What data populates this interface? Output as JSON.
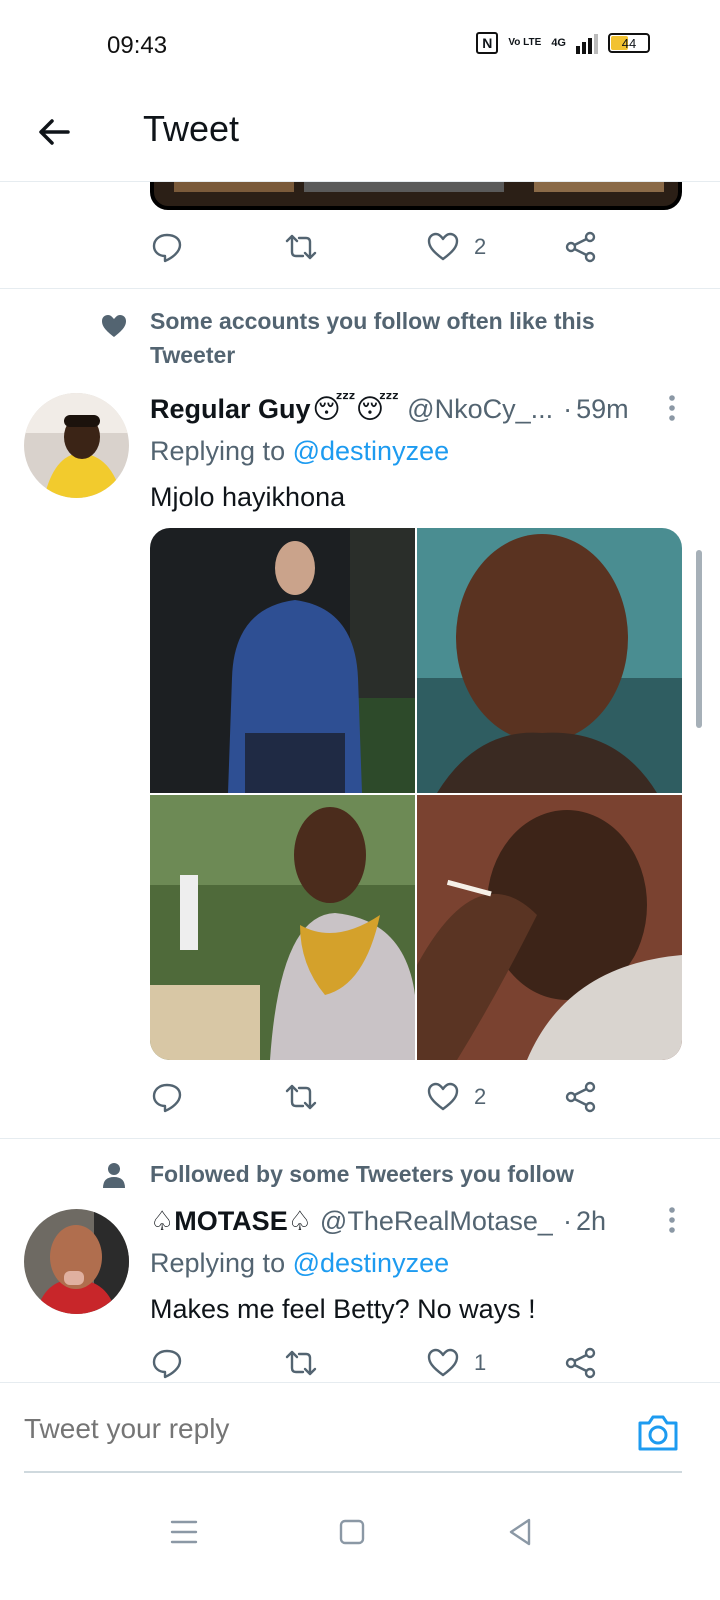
{
  "status_bar": {
    "time": "09:43",
    "network": "4G",
    "volte": "Vo LTE",
    "battery": "44"
  },
  "header": {
    "title": "Tweet"
  },
  "tweet_top": {
    "likes": "2"
  },
  "tweets": [
    {
      "context": "Some accounts you follow often like this Tweeter",
      "context_icon": "heart-icon",
      "name": "Regular Guy",
      "emoji": "😴😴",
      "handle": "@NkoCy_...",
      "dot": "·",
      "time": "59m",
      "replying_prefix": "Replying to",
      "replying_to": "@destinyzee",
      "text": "Mjolo hayikhona",
      "likes": "2"
    },
    {
      "context": "Followed by some Tweeters you follow",
      "context_icon": "person-icon",
      "name": "♤MOTASE♤",
      "handle": "@TheRealMotase_",
      "dot": "·",
      "time": "2h",
      "replying_prefix": "Replying to",
      "replying_to": "@destinyzee",
      "text": "Makes me feel Betty? No ways !",
      "likes": "1"
    }
  ],
  "reply_bar": {
    "placeholder": "Tweet your reply"
  },
  "colors": {
    "accent": "#1d9bf0",
    "muted": "#536471",
    "text": "#0f1419",
    "divider": "#e6ecf0"
  }
}
